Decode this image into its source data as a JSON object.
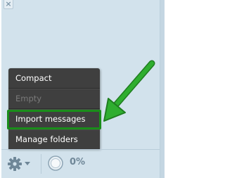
{
  "panel": {
    "close_glyph": "×"
  },
  "menu": {
    "items": [
      {
        "label": "Compact",
        "enabled": true
      },
      {
        "label": "Empty",
        "enabled": false
      },
      {
        "label": "Import messages",
        "enabled": true,
        "highlighted": true
      },
      {
        "label": "Manage folders",
        "enabled": true
      }
    ]
  },
  "footer": {
    "settings_icon": "gear-icon",
    "dropdown_icon": "triangle-down-icon",
    "quota_icon": "pie-quota-icon",
    "quota_value": 0,
    "quota_text": "0%"
  },
  "colors": {
    "panel_bg": "#d2e2ec",
    "menu_bg": "#3f3f3f",
    "menu_text": "#ffffff",
    "menu_text_disabled": "#7a7a7a",
    "highlight": "#1a8d1a",
    "icon": "#6f8798"
  }
}
